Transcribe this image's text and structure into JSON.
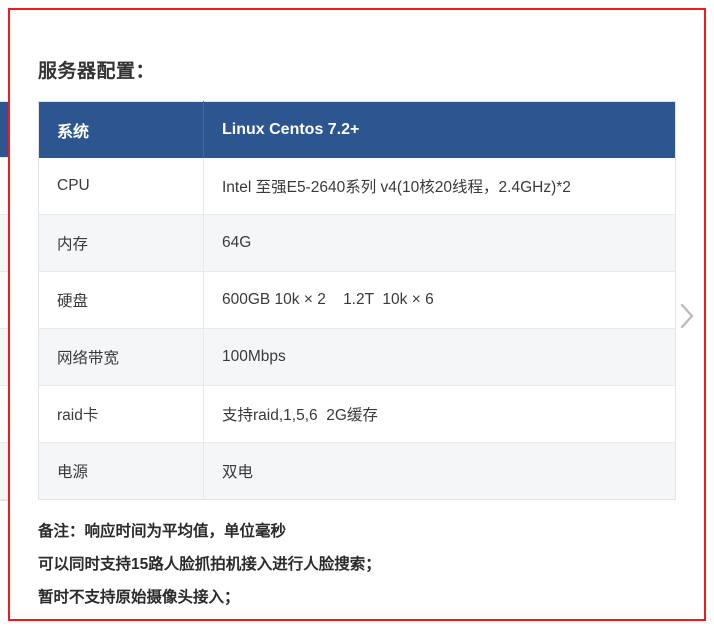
{
  "page": {
    "title": "服务器配置："
  },
  "table": {
    "header": {
      "col1": "系统",
      "col2": "Linux Centos 7.2+"
    },
    "rows": [
      {
        "label": "CPU",
        "value": "Intel 至强E5-2640系列 v4(10核20线程，2.4GHz)*2"
      },
      {
        "label": "内存",
        "value": "64G"
      },
      {
        "label": "硬盘",
        "value": "600GB 10k × 2    1.2T  10k × 6"
      },
      {
        "label": "网络带宽",
        "value": "100Mbps"
      },
      {
        "label": "raid卡",
        "value": "支持raid,1,5,6  2G缓存"
      },
      {
        "label": "电源",
        "value": "双电"
      }
    ]
  },
  "notes": [
    "备注：响应时间为平均值，单位毫秒",
    "可以同时支持15路人脸抓拍机接入进行人脸搜索；",
    "暂时不支持原始摄像头接入；"
  ],
  "nav": {
    "next_label": "›"
  },
  "colors": {
    "header_blue": "#2d558f",
    "row_alt": "#f4f6f8",
    "annotation_red": "#ee1c1c",
    "text": "#3a3a3a"
  }
}
